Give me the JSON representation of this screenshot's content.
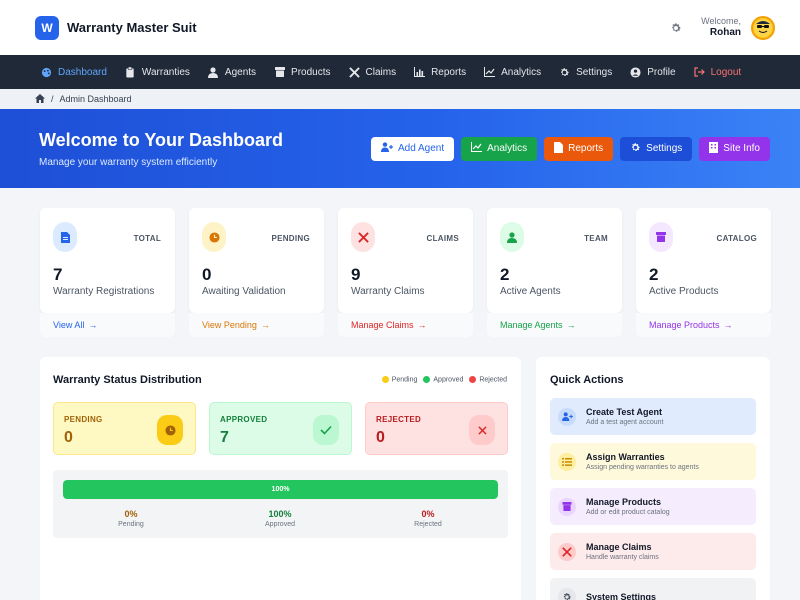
{
  "header": {
    "logo_letter": "W",
    "app_name": "Warranty Master Suit",
    "welcome_text": "Welcome,",
    "user_name": "Rohan"
  },
  "nav": {
    "items": [
      {
        "label": "Dashboard",
        "icon": "palette-icon"
      },
      {
        "label": "Warranties",
        "icon": "clipboard-icon"
      },
      {
        "label": "Agents",
        "icon": "user-icon"
      },
      {
        "label": "Products",
        "icon": "box-icon"
      },
      {
        "label": "Claims",
        "icon": "tools-icon"
      },
      {
        "label": "Reports",
        "icon": "bar-chart-icon"
      },
      {
        "label": "Analytics",
        "icon": "line-chart-icon"
      },
      {
        "label": "Settings",
        "icon": "gear-icon"
      },
      {
        "label": "Profile",
        "icon": "user-circle-icon"
      },
      {
        "label": "Logout",
        "icon": "logout-icon"
      }
    ]
  },
  "breadcrumb": {
    "current": "Admin Dashboard"
  },
  "hero": {
    "title": "Welcome to Your Dashboard",
    "subtitle": "Manage your warranty system efficiently",
    "buttons": {
      "add_agent": "Add Agent",
      "analytics": "Analytics",
      "reports": "Reports",
      "settings": "Settings",
      "site_info": "Site Info"
    }
  },
  "stats": [
    {
      "tag": "TOTAL",
      "value": "7",
      "label": "Warranty Registrations",
      "link": "View All",
      "color": "#2563eb",
      "bg": "#dbeafe"
    },
    {
      "tag": "PENDING",
      "value": "0",
      "label": "Awaiting Validation",
      "link": "View Pending",
      "color": "#d97706",
      "bg": "#fef3c7"
    },
    {
      "tag": "CLAIMS",
      "value": "9",
      "label": "Warranty Claims",
      "link": "Manage Claims",
      "color": "#dc2626",
      "bg": "#fee2e2"
    },
    {
      "tag": "TEAM",
      "value": "2",
      "label": "Active Agents",
      "link": "Manage Agents",
      "color": "#16a34a",
      "bg": "#dcfce7"
    },
    {
      "tag": "CATALOG",
      "value": "2",
      "label": "Active Products",
      "link": "Manage Products",
      "color": "#9333ea",
      "bg": "#f3e8ff"
    }
  ],
  "distribution": {
    "title": "Warranty Status Distribution",
    "legend": [
      "Pending",
      "Approved",
      "Rejected"
    ],
    "boxes": {
      "pending": {
        "label": "PENDING",
        "value": "0"
      },
      "approved": {
        "label": "APPROVED",
        "value": "7"
      },
      "rejected": {
        "label": "REJECTED",
        "value": "0"
      }
    },
    "bar_percent": 100,
    "bar_label": "100%",
    "percents": {
      "pending": {
        "value": "0%",
        "label": "Pending"
      },
      "approved": {
        "value": "100%",
        "label": "Approved"
      },
      "rejected": {
        "value": "0%",
        "label": "Rejected"
      }
    }
  },
  "quick_actions": {
    "title": "Quick Actions",
    "items": [
      {
        "name": "Create Test Agent",
        "desc": "Add a test agent account",
        "icon": "user-plus-icon",
        "color": "#2563eb",
        "bg": "#e0ecfd"
      },
      {
        "name": "Assign Warranties",
        "desc": "Assign pending warranties to agents",
        "icon": "list-icon",
        "color": "#ca8a04",
        "bg": "#fef9db"
      },
      {
        "name": "Manage Products",
        "desc": "Add or edit product catalog",
        "icon": "box-icon",
        "color": "#9333ea",
        "bg": "#f5ecfd"
      },
      {
        "name": "Manage Claims",
        "desc": "Handle warranty claims",
        "icon": "tools-icon",
        "color": "#dc2626",
        "bg": "#fdeaea"
      },
      {
        "name": "System Settings",
        "desc": "",
        "icon": "gear-icon",
        "color": "#4b5563",
        "bg": "#f1f2f4"
      }
    ]
  }
}
